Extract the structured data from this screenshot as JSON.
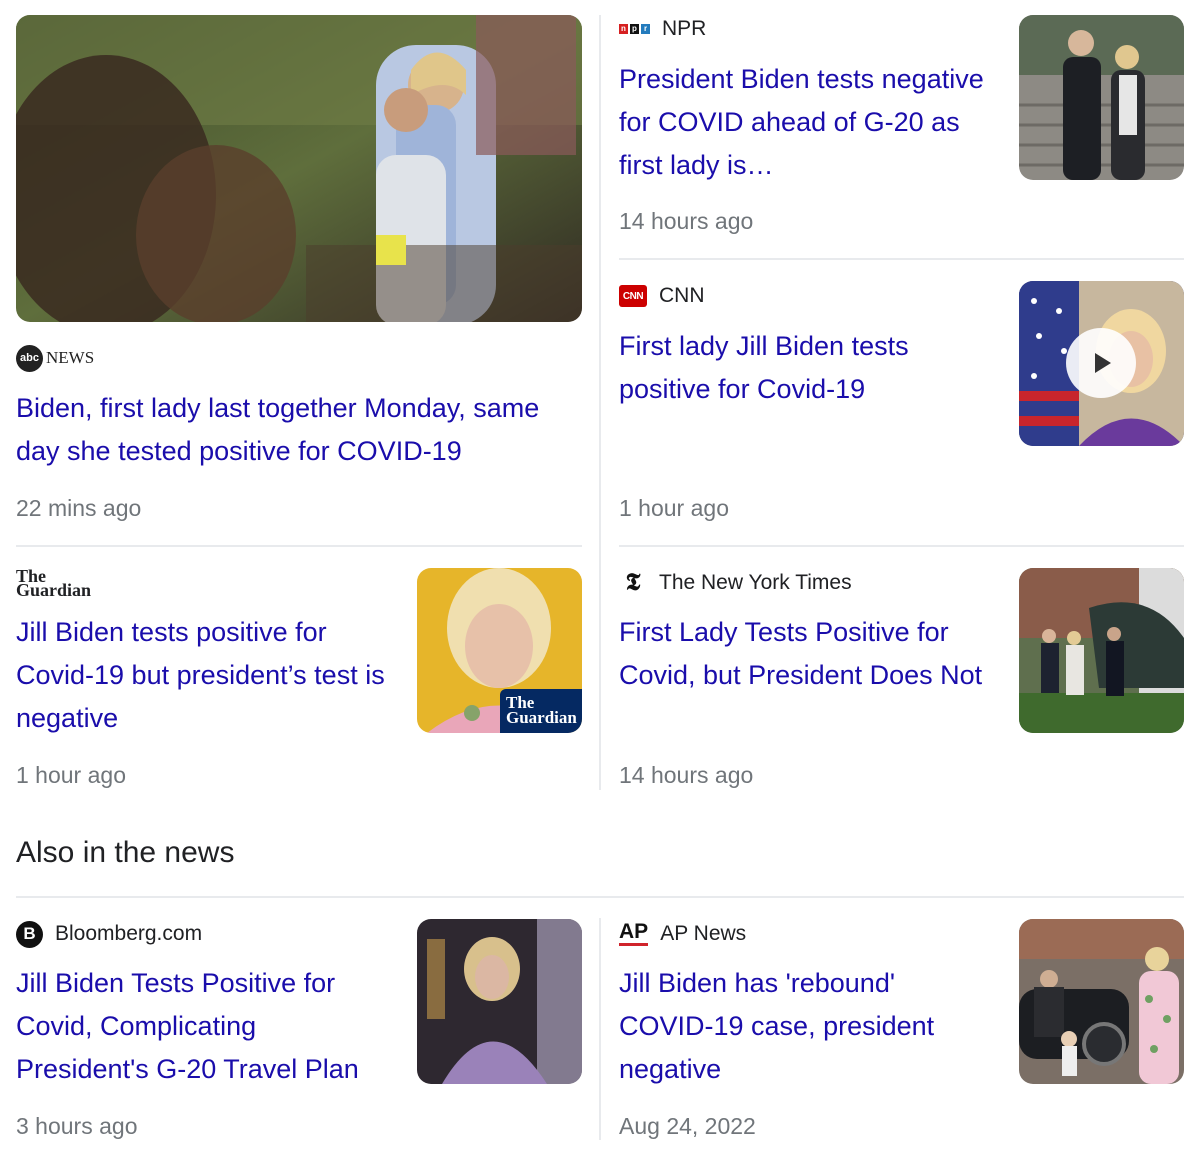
{
  "colors": {
    "headline": "#1a0dab",
    "time": "#70757a",
    "divider": "#e8eaed"
  },
  "stories": [
    {
      "source": "NEWS",
      "source_logo": "abc-news-logo",
      "headline": "Biden, first lady last together Monday, same day she tested positive for COVID-19",
      "time": "22 mins ago",
      "image": "crowd-handshake-photo"
    },
    {
      "source": "NPR",
      "source_logo": "npr-logo",
      "headline": "President Biden tests negative for COVID ahead of G-20 as first lady is…",
      "time": "14 hours ago",
      "image": "biden-couple-stairs-photo"
    },
    {
      "source": "CNN",
      "source_logo": "cnn-logo",
      "headline": "First lady Jill Biden tests positive for Covid-19",
      "time": "1 hour ago",
      "image": "jill-biden-flag-video-thumbnail"
    },
    {
      "source": "The Guardian",
      "source_logo": "guardian-logo",
      "headline": "Jill Biden tests positive for Covid-19 but president’s test is negative",
      "time": "1 hour ago",
      "image": "jill-biden-portrait-photo",
      "image_overlay": "The Guardian"
    },
    {
      "source": "The New York Times",
      "source_logo": "nyt-logo",
      "headline": "First Lady Tests Positive for Covid, but President Does Not",
      "time": "14 hours ago",
      "image": "helicopter-lawn-photo"
    }
  ],
  "also_section": {
    "title": "Also in the news",
    "stories": [
      {
        "source": "Bloomberg.com",
        "source_logo": "bloomberg-logo",
        "headline": "Jill Biden Tests Positive for Covid, Complicating President's G-20 Travel Plan",
        "time": "3 hours ago",
        "image": "jill-biden-purple-photo"
      },
      {
        "source": "AP News",
        "source_logo": "ap-logo",
        "source_logo_text": "AP",
        "headline": "Jill Biden has 'rebound' COVID-19 case, president negative",
        "time": "Aug 24, 2022",
        "image": "biden-car-child-photo"
      }
    ]
  }
}
